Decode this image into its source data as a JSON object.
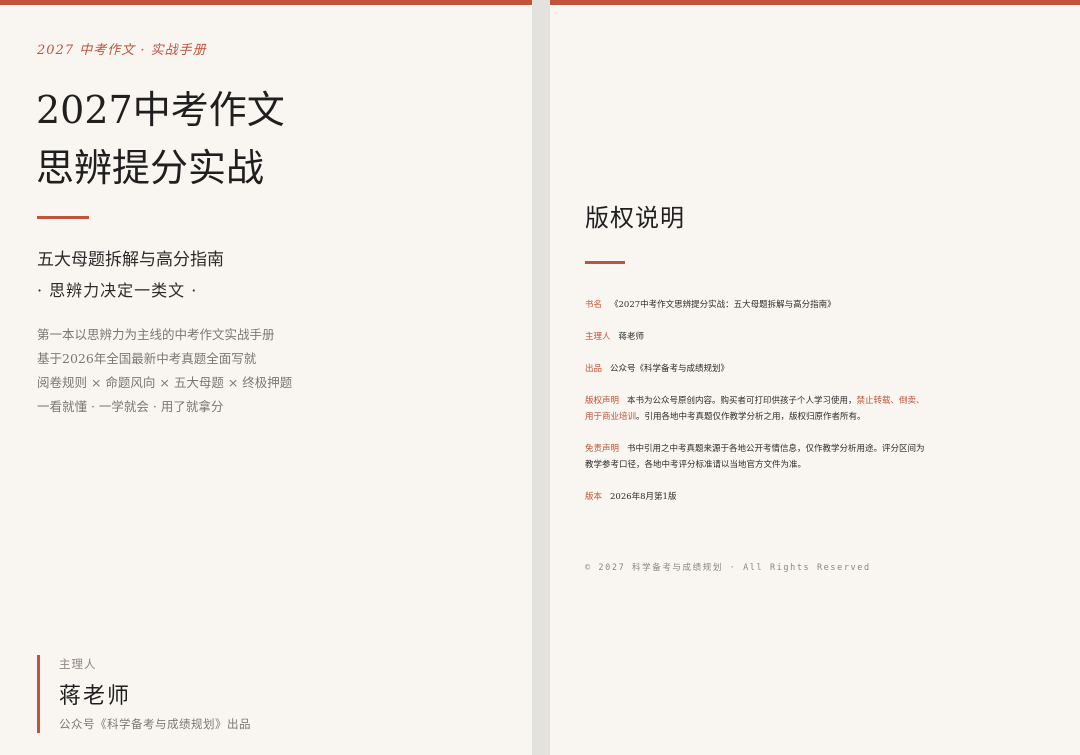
{
  "cover": {
    "series": "2027 中考作文 · 实战手册",
    "title_line1": "2027中考作文",
    "title_line2": "思辨提分实战",
    "subtitle": "五大母题拆解与高分指南",
    "slogan": "· 思辨力决定一类文 ·",
    "features": [
      "第一本以思辨力为主线的中考作文实战手册",
      "基于2026年全国最新中考真题全面写就",
      "阅卷规则 × 命题风向 × 五大母题 × 终极押题",
      "一看就懂 · 一学就会 · 用了就拿分"
    ],
    "author_role": "主理人",
    "author_name": "蒋老师",
    "author_publisher": "公众号《科学备考与成绩规划》出品"
  },
  "copyright": {
    "heading": "版权说明",
    "rows": [
      {
        "label": "书名",
        "text": "《2027中考作文思辨提分实战：五大母题拆解与高分指南》"
      },
      {
        "label": "主理人",
        "text": "蒋老师"
      },
      {
        "label": "出品",
        "text": "公众号《科学备考与成绩规划》"
      },
      {
        "label": "版权声明",
        "text_before": "本书为公众号原创内容。购买者可打印供孩子个人学习使用，",
        "text_highlight": "禁止转载、倒卖、用于商业培训",
        "text_after": "。引用各地中考真题仅作教学分析之用，版权归原作者所有。"
      },
      {
        "label": "免责声明",
        "text": "书中引用之中考真题来源于各地公开考情信息，仅作教学分析用途。评分区间为教学参考口径，各地中考评分标准请以当地官方文件为准。"
      },
      {
        "label": "版本",
        "text": "2026年8月第1版"
      }
    ],
    "footer": "© 2027 科学备考与成绩规划 · All Rights Reserved"
  },
  "colors": {
    "accent": "#c0533a",
    "page_bg": "#f9f6f1",
    "text": "#1f1f1f",
    "muted": "#7b7772"
  }
}
